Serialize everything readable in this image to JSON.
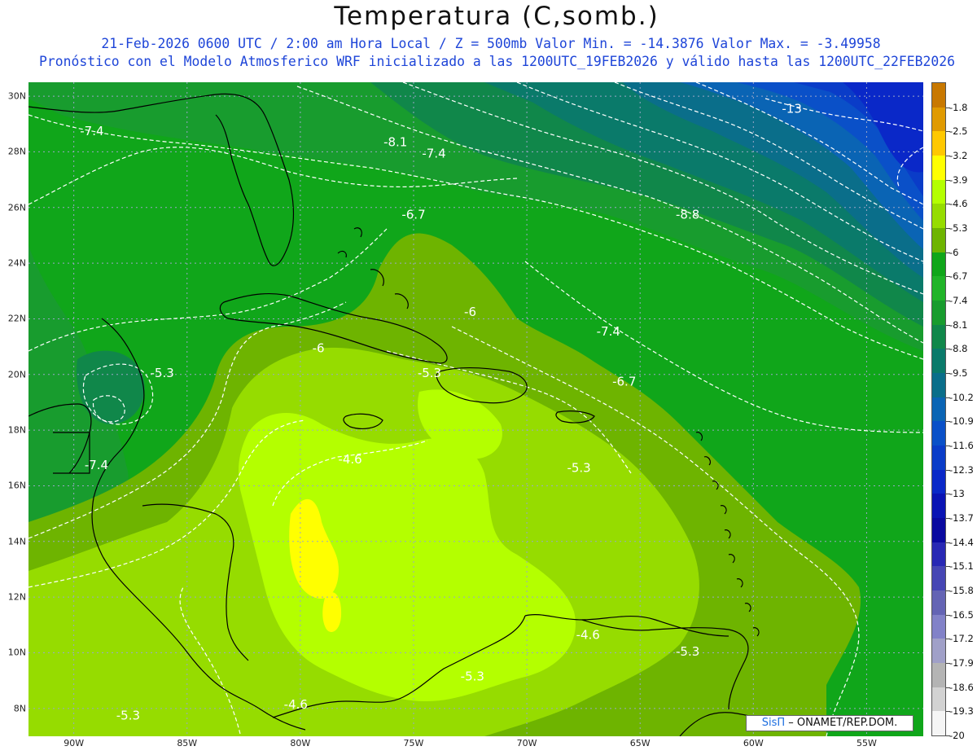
{
  "title": "Temperatura (C,somb.)",
  "subtitle_line1": "21-Feb-2026  0600 UTC / 2:00 am Hora Local / Z = 500mb  Valor Min. = -14.3876  Valor Max. = -3.49958",
  "subtitle_line2": "Pronóstico con el Modelo Atmosferico WRF inicializado a las 1200UTC_19FEB2026 y válido hasta las  1200UTC_22FEB2026",
  "credit": {
    "brand": "SisΠ",
    "text": "– ONAMET/REP.DOM."
  },
  "lat_labels": [
    "30N",
    "28N",
    "26N",
    "24N",
    "22N",
    "20N",
    "18N",
    "16N",
    "14N",
    "12N",
    "10N",
    "8N"
  ],
  "lon_labels": [
    "90W",
    "85W",
    "80W",
    "75W",
    "70W",
    "65W",
    "60W",
    "55W"
  ],
  "colorbar": {
    "labels": [
      "-1.8",
      "-2.5",
      "-3.2",
      "-3.9",
      "-4.6",
      "-5.3",
      "-6",
      "-6.7",
      "-7.4",
      "-8.1",
      "-8.8",
      "-9.5",
      "-10.2",
      "-10.9",
      "-11.6",
      "-12.3",
      "-13",
      "-13.7",
      "-14.4",
      "-15.1",
      "-15.8",
      "-16.5",
      "-17.2",
      "-17.9",
      "-18.6",
      "-19.3",
      "-20"
    ],
    "colors": [
      "#c87800",
      "#e09a00",
      "#ffc800",
      "#ffff00",
      "#b4ff00",
      "#96dc00",
      "#6eb400",
      "#10a61a",
      "#20b428",
      "#189c2e",
      "#10874a",
      "#0a7a6a",
      "#0a6e8a",
      "#0a64b4",
      "#0a50c8",
      "#0a3cc8",
      "#0a28c8",
      "#0a14b4",
      "#0a0aa0",
      "#2828b4",
      "#4646b4",
      "#6464b4",
      "#8282c8",
      "#a0a0c8",
      "#b4b4b4",
      "#d2d2d2",
      "#f5f5f5"
    ]
  },
  "chart_data": {
    "type": "heatmap",
    "title": "Temperatura (C,somb.)",
    "variable": "Temperature (C), 500mb",
    "valid": "21-Feb-2026 0600 UTC",
    "value_min": -14.3876,
    "value_max": -3.49958,
    "lon_range": [
      -92,
      -52.5
    ],
    "lat_range": [
      7,
      30.5
    ],
    "contour_labels": [
      {
        "text": "-7.4",
        "lon": -89.2,
        "lat": 28.6
      },
      {
        "text": "-8.1",
        "lon": -75.8,
        "lat": 28.2
      },
      {
        "text": "-7.4",
        "lon": -74.1,
        "lat": 27.8
      },
      {
        "text": "-13",
        "lon": -58.3,
        "lat": 29.4
      },
      {
        "text": "-6.7",
        "lon": -75.0,
        "lat": 25.6
      },
      {
        "text": "-8.8",
        "lon": -62.9,
        "lat": 25.6
      },
      {
        "text": "-6",
        "lon": -72.5,
        "lat": 22.1
      },
      {
        "text": "-6",
        "lon": -79.2,
        "lat": 20.8
      },
      {
        "text": "-7.4",
        "lon": -66.4,
        "lat": 21.4
      },
      {
        "text": "-5.3",
        "lon": -86.1,
        "lat": 19.9
      },
      {
        "text": "-5.3",
        "lon": -74.3,
        "lat": 19.9
      },
      {
        "text": "-6.7",
        "lon": -65.7,
        "lat": 19.6
      },
      {
        "text": "-7.4",
        "lon": -89.0,
        "lat": 16.6
      },
      {
        "text": "-4.6",
        "lon": -77.8,
        "lat": 16.8
      },
      {
        "text": "-5.3",
        "lon": -67.7,
        "lat": 16.5
      },
      {
        "text": "-4.6",
        "lon": -67.3,
        "lat": 10.5
      },
      {
        "text": "-5.3",
        "lon": -62.9,
        "lat": 9.9
      },
      {
        "text": "-5.3",
        "lon": -72.4,
        "lat": 9.0
      },
      {
        "text": "-4.6",
        "lon": -80.2,
        "lat": 8.0
      },
      {
        "text": "-5.3",
        "lon": -87.6,
        "lat": 7.6
      }
    ]
  }
}
